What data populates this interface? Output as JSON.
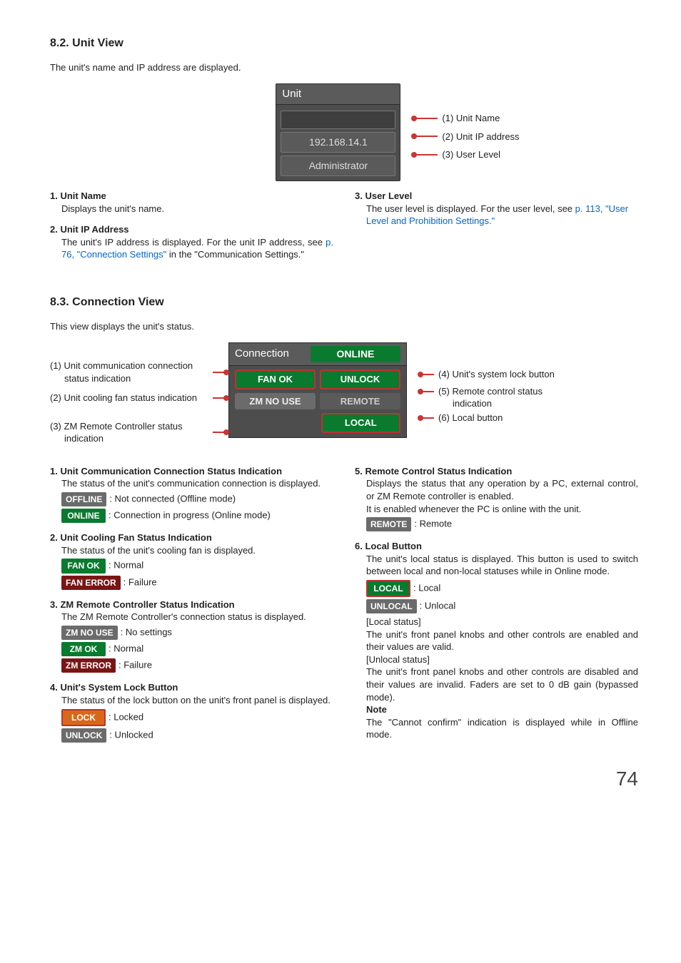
{
  "section1": {
    "heading": "8.2. Unit View",
    "intro": "The unit's name and IP address are displayed.",
    "panel": {
      "title": "Unit",
      "ip": "192.168.14.1",
      "user": "Administrator"
    },
    "callouts": {
      "c1": "(1) Unit Name",
      "c2": "(2) Unit IP address",
      "c3": "(3) User Level"
    },
    "left": {
      "i1_title": "1. Unit Name",
      "i1_body": "Displays the unit's name.",
      "i2_title": "2. Unit IP Address",
      "i2_body_a": "The unit's IP address is displayed. For the unit IP address, see ",
      "i2_link": "p. 76, \"Connection Settings\"",
      "i2_body_b": " in the \"Communication Settings.\""
    },
    "right": {
      "i3_title": "3. User Level",
      "i3_body_a": "The user level is displayed. For the user level, see ",
      "i3_link": "p. 113, \"User Level and Prohibition Settings.\""
    }
  },
  "section2": {
    "heading": "8.3. Connection View",
    "intro": "This view displays the unit's status.",
    "left_callouts": {
      "c1a": "(1) Unit communication connection",
      "c1b": "status indication",
      "c2": "(2) Unit cooling fan status indication",
      "c3a": "(3) ZM Remote Controller status",
      "c3b": "indication"
    },
    "panel": {
      "title": "Connection",
      "online": "ONLINE",
      "fanok": "FAN OK",
      "unlock": "UNLOCK",
      "zmnouse": "ZM NO USE",
      "remote": "REMOTE",
      "local": "LOCAL"
    },
    "right_callouts": {
      "c4": "(4) Unit's system lock button",
      "c5a": "(5) Remote control status",
      "c5b": "indication",
      "c6": "(6) Local button"
    },
    "desc_left": {
      "t1": "1. Unit Communication Connection Status Indication",
      "b1": "The status of the unit's communication connection is displayed.",
      "offline": "OFFLINE",
      "offline_d": ": Not connected (Offline mode)",
      "online": "ONLINE",
      "online_d": ": Connection in progress (Online mode)",
      "t2": "2. Unit Cooling Fan Status Indication",
      "b2": "The status of the unit's cooling fan is displayed.",
      "fanok": "FAN OK",
      "fanok_d": ": Normal",
      "fanerr": "FAN ERROR",
      "fanerr_d": ": Failure",
      "t3": "3. ZM Remote Controller Status Indication",
      "b3": "The ZM Remote Controller's connection status is displayed.",
      "zmnouse": "ZM NO USE",
      "zmnouse_d": ": No settings",
      "zmok": "ZM OK",
      "zmok_d": ": Normal",
      "zmerr": "ZM ERROR",
      "zmerr_d": ": Failure",
      "t4": "4. Unit's System Lock Button",
      "b4": "The status of the lock button on the unit's front panel is displayed.",
      "lock": "LOCK",
      "lock_d": ": Locked",
      "unlockb": "UNLOCK",
      "unlock_d": ": Unlocked"
    },
    "desc_right": {
      "t5": "5. Remote Control Status Indication",
      "b5a": "Displays the status that any operation by a PC, external control, or ZM Remote controller is enabled.",
      "b5b": "It is enabled whenever the PC is online with the unit.",
      "remote": "REMOTE",
      "remote_d": ": Remote",
      "t6": "6. Local Button",
      "b6": "The unit's local status is displayed. This button is used to switch between local and non-local statuses while in Online mode.",
      "local": "LOCAL",
      "local_d": ": Local",
      "unlocal": "UNLOCAL",
      "unlocal_d": ": Unlocal",
      "localstatus_h": "[Local status]",
      "localstatus_b": "The unit's front panel knobs and other controls are enabled and their values are valid.",
      "unlocalstatus_h": "[Unlocal status]",
      "unlocalstatus_b": "The unit's front panel knobs and other controls are disabled and their values are invalid. Faders are set to 0 dB gain (bypassed mode).",
      "note_h": "Note",
      "note_b": "The \"Cannot confirm\" indication is displayed while in Offline mode."
    }
  },
  "pagenum": "74"
}
